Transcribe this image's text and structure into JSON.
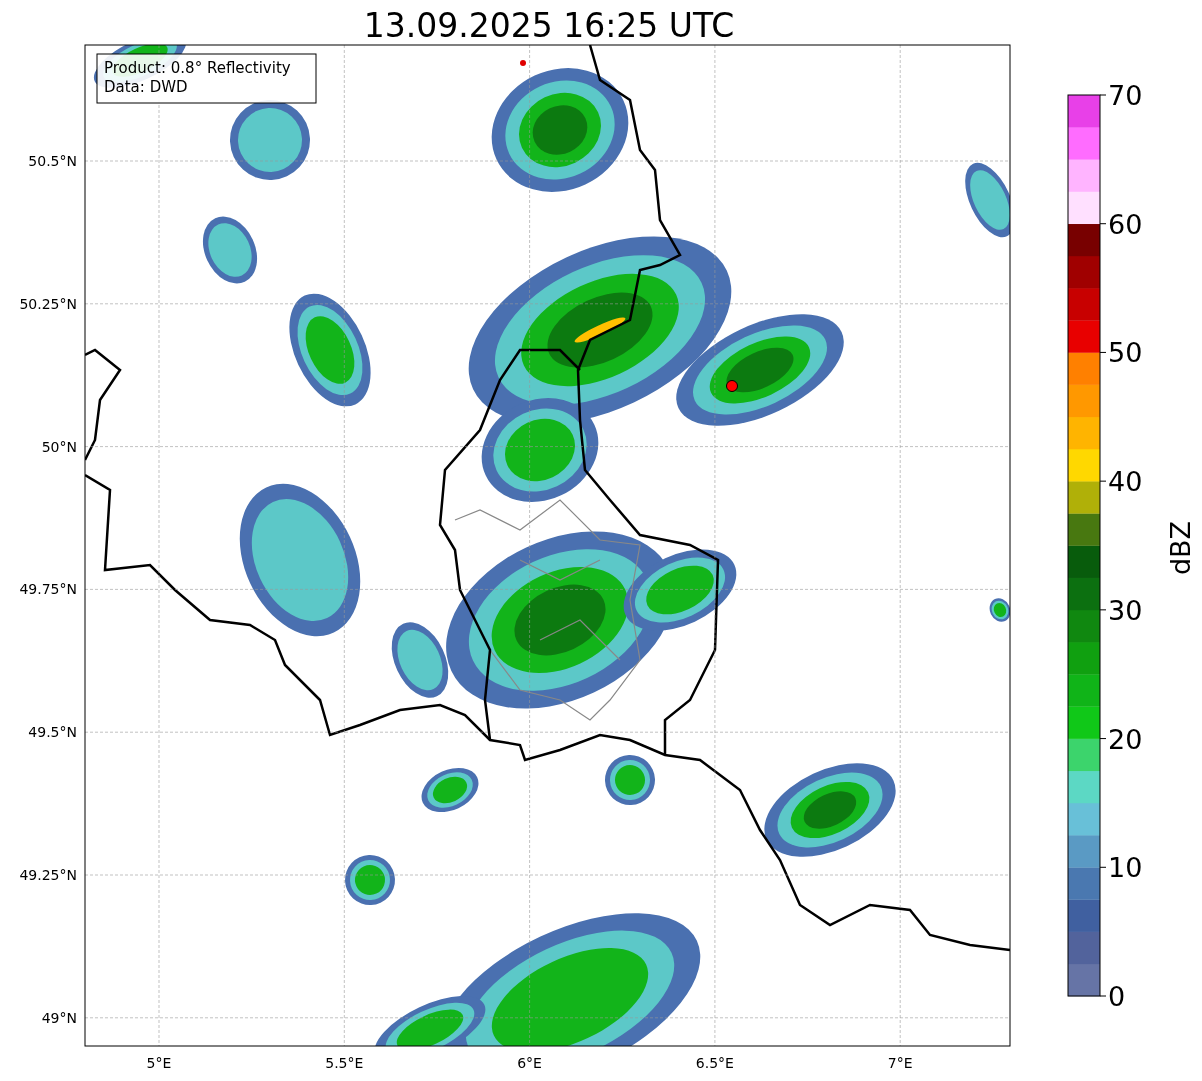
{
  "title": "13.09.2025 16:25 UTC",
  "legend": {
    "lines": [
      "Product: 0.8° Reflectivity",
      "Data: DWD"
    ]
  },
  "map": {
    "lat_ticks": [
      {
        "label": "50.5°N"
      },
      {
        "label": "50.25°N"
      },
      {
        "label": "50°N"
      },
      {
        "label": "49.75°N"
      },
      {
        "label": "49.5°N"
      },
      {
        "label": "49.25°N"
      },
      {
        "label": "49°N"
      }
    ],
    "lon_ticks": [
      {
        "label": "5°E"
      },
      {
        "label": "5.5°E"
      },
      {
        "label": "6°E"
      },
      {
        "label": "6.5°E"
      },
      {
        "label": "7°E"
      }
    ]
  },
  "colorbar": {
    "label": "dBZ",
    "ticks": [
      {
        "label": "70"
      },
      {
        "label": "60"
      },
      {
        "label": "50"
      },
      {
        "label": "40"
      },
      {
        "label": "30"
      },
      {
        "label": "20"
      },
      {
        "label": "10"
      },
      {
        "label": "0"
      }
    ],
    "segments": [
      {
        "color": "#6674a6"
      },
      {
        "color": "#52639c"
      },
      {
        "color": "#4060a0"
      },
      {
        "color": "#4a78b0"
      },
      {
        "color": "#5a9ac4"
      },
      {
        "color": "#68c0d8"
      },
      {
        "color": "#5cd8c4"
      },
      {
        "color": "#3cd46c"
      },
      {
        "color": "#10c818"
      },
      {
        "color": "#10b418"
      },
      {
        "color": "#10a010"
      },
      {
        "color": "#108810"
      },
      {
        "color": "#0c7010"
      },
      {
        "color": "#085c0c"
      },
      {
        "color": "#487810"
      },
      {
        "color": "#b0b008"
      },
      {
        "color": "#ffd800"
      },
      {
        "color": "#ffb400"
      },
      {
        "color": "#ff9800"
      },
      {
        "color": "#ff8000"
      },
      {
        "color": "#e80000"
      },
      {
        "color": "#c80000"
      },
      {
        "color": "#a00000"
      },
      {
        "color": "#780000"
      },
      {
        "color": "#ffe0ff"
      },
      {
        "color": "#ffb4ff"
      },
      {
        "color": "#ff6cff"
      },
      {
        "color": "#e840e8"
      }
    ]
  }
}
